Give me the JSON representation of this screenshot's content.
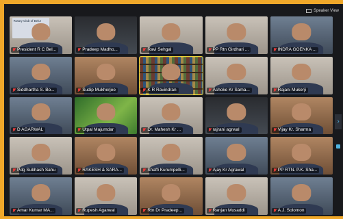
{
  "topbar": {
    "view_label": "Speaker View"
  },
  "participants": [
    {
      "name": "President R C Bel...",
      "style": "logo",
      "board": "Rotary Club of Belur"
    },
    {
      "name": "Pradeep Madho...",
      "style": "dark-bg"
    },
    {
      "name": "Ravi Sehgal",
      "style": "light-bg"
    },
    {
      "name": "PP Rtn Girdhari ...",
      "style": "light-bg"
    },
    {
      "name": "INDRA GOENKA ...",
      "style": "cool-bg"
    },
    {
      "name": "Siddhartha S. Bo...",
      "style": "cool-bg"
    },
    {
      "name": "Sudip Mukherjee",
      "style": "warm-bg"
    },
    {
      "name": "K R Ravindran",
      "style": "shelf",
      "active": true
    },
    {
      "name": "Ashoke Kr Sama...",
      "style": "light-bg"
    },
    {
      "name": "Rajani Mukerji",
      "style": "light-bg"
    },
    {
      "name": "D AGARWAL",
      "style": "cool-bg"
    },
    {
      "name": "Utpal Majumdar",
      "style": "green-bg"
    },
    {
      "name": "Dr. Mahesh Kr ...",
      "style": "light-bg"
    },
    {
      "name": "rajrani agrwal",
      "style": "dark-bg"
    },
    {
      "name": "Vijay Kr. Sharma",
      "style": "warm-bg"
    },
    {
      "name": "Pdg Subhash Sahu",
      "style": "light-bg"
    },
    {
      "name": "RAKESH & SARA...",
      "style": "warm-bg"
    },
    {
      "name": "Shaffi Kurumpelli...",
      "style": "light-bg"
    },
    {
      "name": "Ajay Kr Agrawal",
      "style": "cool-bg"
    },
    {
      "name": "PP RTN. P.K. Sha...",
      "style": "warm-bg"
    },
    {
      "name": "Amar Kumar MA...",
      "style": "cool-bg"
    },
    {
      "name": "Rupesh Agarwal",
      "style": "light-bg"
    },
    {
      "name": "Rtn Dr Pradeep...",
      "style": "warm-bg"
    },
    {
      "name": "Ranjan Musaddi",
      "style": "light-bg"
    },
    {
      "name": "A.J. Solomon",
      "style": "cool-bg"
    }
  ],
  "colors": {
    "border": "#f0a82a",
    "active_outline": "#e8d23a",
    "muted": "#e23b3b"
  }
}
